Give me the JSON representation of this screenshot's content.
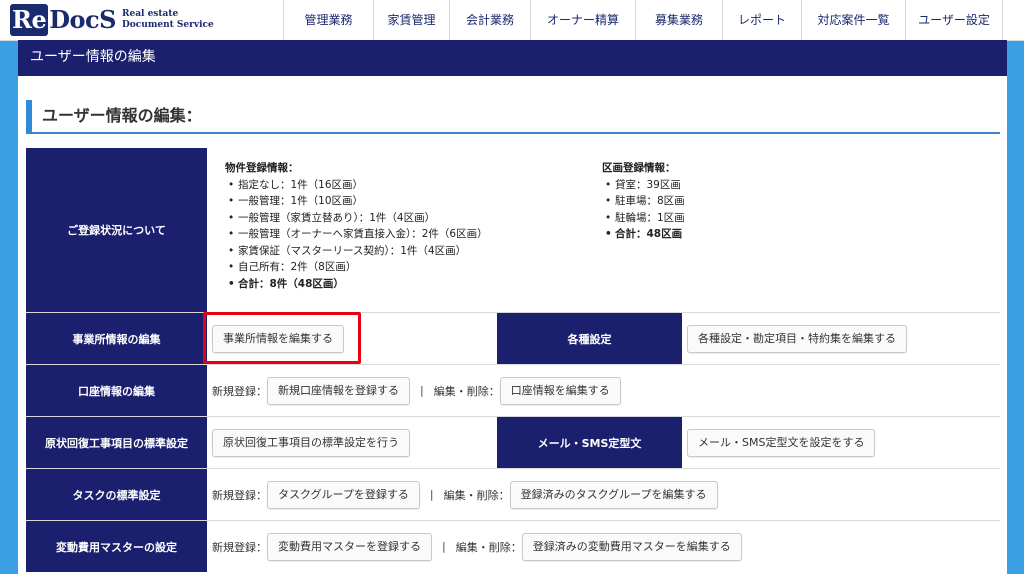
{
  "logo": {
    "mark_re": "Re",
    "mark_docs": "DocS",
    "line1": "Real estate",
    "line2": "Document Service"
  },
  "nav": [
    "管理業務",
    "家賃管理",
    "会計業務",
    "オーナー精算",
    "募集業務",
    "レポート",
    "対応案件一覧",
    "ユーザー設定"
  ],
  "page_header": "ユーザー情報の編集",
  "section_title": "ユーザー情報の編集：",
  "registration": {
    "label": "ご登録状況について",
    "property": {
      "title": "物件登録情報：",
      "items": [
        "指定なし：1件（16区画）",
        "一般管理：1件（10区画）",
        "一般管理（家賃立替あり）：1件（4区画）",
        "一般管理（オーナーへ家賃直接入金）：2件（6区画）",
        "家賃保証（マスターリース契約）：1件（4区画）",
        "自己所有：2件（8区画）"
      ],
      "total": "合計：8件（48区画）"
    },
    "section": {
      "title": "区画登録情報：",
      "items": [
        "貸室：39区画",
        "駐車場：8区画",
        "駐輪場：1区画"
      ],
      "total": "合計：48区画"
    }
  },
  "office": {
    "label": "事業所情報の編集",
    "button": "事業所情報を編集する"
  },
  "misc": {
    "label": "各種設定",
    "button": "各種設定・勘定項目・特約集を編集する"
  },
  "account": {
    "label": "口座情報の編集",
    "new_prefix": "新規登録：",
    "new_button": "新規口座情報を登録する",
    "separator": "|",
    "edit_prefix": "編集・削除：",
    "edit_button": "口座情報を編集する"
  },
  "restoration": {
    "label": "原状回復工事項目の標準設定",
    "button": "原状回復工事項目の標準設定を行う"
  },
  "mail": {
    "label": "メール・SMS定型文",
    "button": "メール・SMS定型文を設定をする"
  },
  "task": {
    "label": "タスクの標準設定",
    "new_prefix": "新規登録：",
    "new_button": "タスクグループを登録する",
    "separator": "|",
    "edit_prefix": "編集・削除：",
    "edit_button": "登録済みのタスクグループを編集する"
  },
  "variable_cost": {
    "label": "変動費用マスターの設定",
    "new_prefix": "新規登録：",
    "new_button": "変動費用マスターを登録する",
    "separator": "|",
    "edit_prefix": "編集・削除：",
    "edit_button": "登録済みの変動費用マスターを編集する"
  },
  "colors": {
    "navy": "#1a1f6e",
    "accent_blue": "#2f8ad8",
    "background": "#3b9fe3",
    "highlight_red": "#e60012"
  }
}
